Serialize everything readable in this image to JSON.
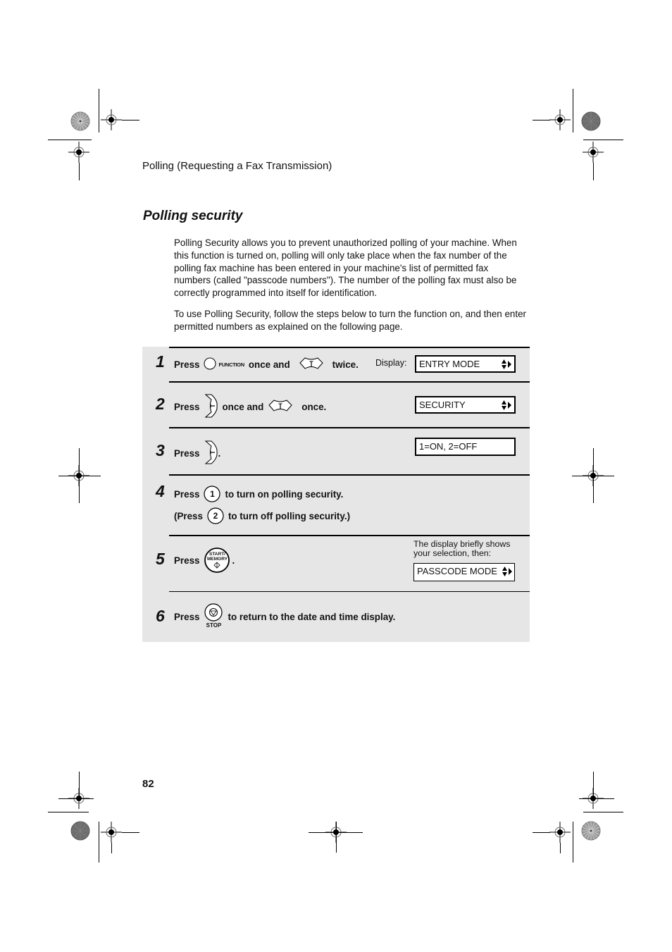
{
  "page": {
    "running_head": "Polling (Requesting a Fax Transmission)",
    "section_title": "Polling security",
    "intro_paragraphs": [
      "Polling Security allows you to prevent unauthorized polling of your machine. When this function is turned on, polling will only take place when the fax number of the polling fax machine has been entered in your machine's list of permitted fax numbers (called \"passcode numbers\"). The number of the polling fax must also be correctly programmed into itself for identification.",
      "To use Polling Security, follow the steps below to turn the function on, and then enter permitted numbers as explained on the following page."
    ],
    "page_number": "82"
  },
  "steps": [
    {
      "number": "1",
      "press": "Press",
      "key1_label": "FUNCTION",
      "mid": "once and",
      "end": "twice.",
      "display_label": "Display:",
      "display": "ENTRY MODE"
    },
    {
      "number": "2",
      "press": "Press",
      "mid": "once and",
      "end": "once.",
      "display": "SECURITY"
    },
    {
      "number": "3",
      "press": "Press",
      "end": ".",
      "display": "1=ON, 2=OFF"
    },
    {
      "number": "4",
      "press": "Press",
      "key1": "1",
      "end": "to turn on polling security.",
      "alt_press": "(Press",
      "key2": "2",
      "alt_end": "to turn off polling security.)"
    },
    {
      "number": "5",
      "press": "Press",
      "key_label_top": "START/",
      "key_label_bottom": "MEMORY",
      "end": ".",
      "note": "The display briefly shows your selection, then:",
      "display": "PASSCODE MODE"
    },
    {
      "number": "6",
      "press": "Press",
      "key_label": "STOP",
      "end": "to return to the date and time display."
    }
  ],
  "colors": {
    "steps_background": "#e6e6e6",
    "rule": "#000000",
    "text": "#111111"
  }
}
